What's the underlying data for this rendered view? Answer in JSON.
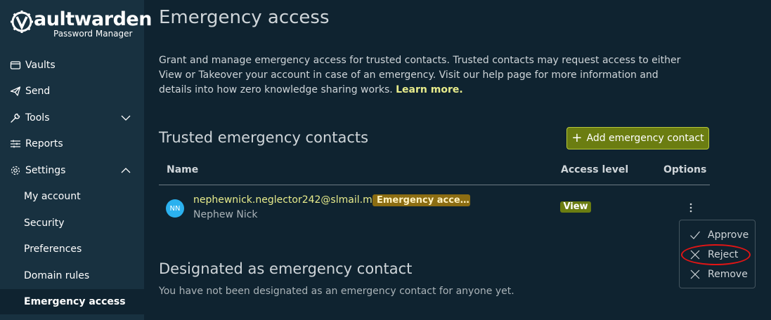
{
  "brand": {
    "name": "Vaultwarden",
    "subtitle": "Password Manager"
  },
  "sidebar": {
    "items": [
      {
        "label": "Vaults",
        "icon": "vault-icon"
      },
      {
        "label": "Send",
        "icon": "send-icon"
      },
      {
        "label": "Tools",
        "icon": "wrench-icon",
        "chevron": "down"
      },
      {
        "label": "Reports",
        "icon": "sliders-icon"
      },
      {
        "label": "Settings",
        "icon": "gear-icon",
        "chevron": "up"
      }
    ],
    "settings_sub": [
      {
        "label": "My account"
      },
      {
        "label": "Security"
      },
      {
        "label": "Preferences"
      },
      {
        "label": "Domain rules"
      },
      {
        "label": "Emergency access",
        "active": true
      }
    ]
  },
  "main": {
    "title": "Emergency access",
    "description": "Grant and manage emergency access for trusted contacts. Trusted contacts may request access to either View or Takeover your account in case of an emergency. Visit our help page for more information and details into how zero knowledge sharing works.",
    "learn_more": "Learn more.",
    "trusted_heading": "Trusted emergency contacts",
    "add_button": "Add emergency contact",
    "table": {
      "headers": {
        "name": "Name",
        "access": "Access level",
        "options": "Options"
      },
      "rows": [
        {
          "initials": "NN",
          "email": "nephewnick.neglector242@slmail.me",
          "status": "Emergency acce…",
          "name": "Nephew Nick",
          "access": "View"
        }
      ]
    },
    "options_menu": {
      "approve": "Approve",
      "reject": "Reject",
      "remove": "Remove"
    },
    "designated_heading": "Designated as emergency contact",
    "designated_empty": "You have not been designated as an emergency contact for anyone yet."
  },
  "colors": {
    "background": "#0f2330",
    "sidebar": "#183140",
    "accent": "#6b7d11",
    "link": "#e8ec8c",
    "warning_badge": "#8c6d12",
    "avatar": "#2bb1ef",
    "highlight_ring": "#e11515"
  }
}
